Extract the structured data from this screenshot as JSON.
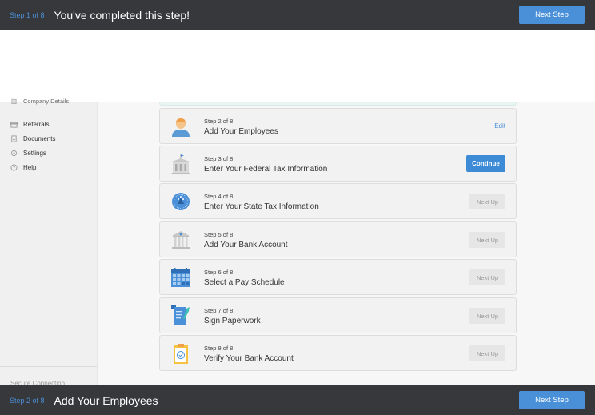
{
  "top_bar": {
    "step": "Step 1 of 8",
    "title": "You've completed this step!",
    "button": "Next Step"
  },
  "bottom_bar": {
    "step": "Step 2 of 8",
    "title": "Add Your Employees",
    "button": "Next Step"
  },
  "sidebar": {
    "partial_item": "Company Details",
    "items": [
      {
        "label": "Referrals",
        "icon": "gift-icon"
      },
      {
        "label": "Documents",
        "icon": "document-icon"
      },
      {
        "label": "Settings",
        "icon": "gear-icon"
      },
      {
        "label": "Help",
        "icon": "help-icon"
      }
    ],
    "footer": "Secure Connection"
  },
  "steps": [
    {
      "step": "Step 2 of 8",
      "title": "Add Your Employees",
      "action": "Edit",
      "icon": "employee-avatar-icon"
    },
    {
      "step": "Step 3 of 8",
      "title": "Enter Your Federal Tax Information",
      "action": "Continue",
      "icon": "federal-building-icon"
    },
    {
      "step": "Step 4 of 8",
      "title": "Enter Your State Tax Information",
      "action": "Next Up",
      "icon": "state-seal-icon"
    },
    {
      "step": "Step 5 of 8",
      "title": "Add Your Bank Account",
      "action": "Next Up",
      "icon": "bank-icon"
    },
    {
      "step": "Step 6 of 8",
      "title": "Select a Pay Schedule",
      "action": "Next Up",
      "icon": "calendar-icon"
    },
    {
      "step": "Step 7 of 8",
      "title": "Sign Paperwork",
      "action": "Next Up",
      "icon": "paperwork-icon"
    },
    {
      "step": "Step 8 of 8",
      "title": "Verify Your Bank Account",
      "action": "Next Up",
      "icon": "clipboard-check-icon"
    }
  ],
  "colors": {
    "bar": "#37383b",
    "accent": "#4a90d9",
    "continue": "#3d8bd6"
  }
}
